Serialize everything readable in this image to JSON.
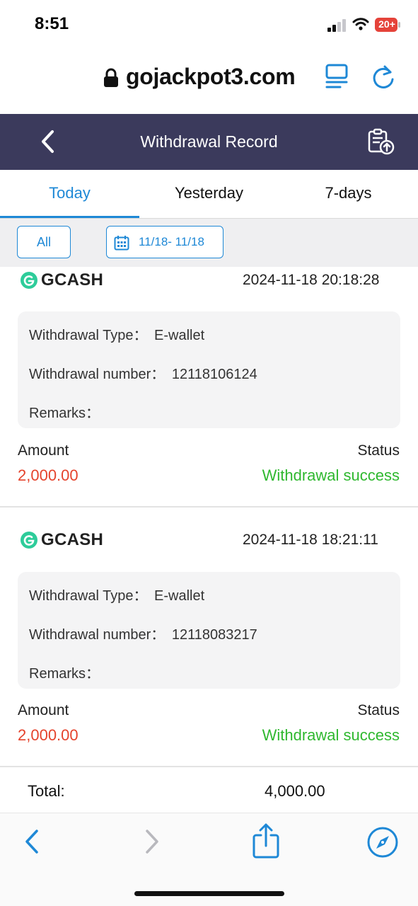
{
  "status_bar": {
    "time": "8:51",
    "battery": "20+"
  },
  "browser": {
    "url": "gojackpot3.com"
  },
  "header": {
    "title": "Withdrawal Record"
  },
  "tabs": [
    {
      "label": "Today",
      "active": true
    },
    {
      "label": "Yesterday",
      "active": false
    },
    {
      "label": "7-days",
      "active": false
    }
  ],
  "filters": {
    "all_label": "All",
    "date_range": "11/18- 11/18"
  },
  "records": [
    {
      "brand": "GCASH",
      "datetime": "2024-11-18 20:18:28",
      "type_label": "Withdrawal Type：",
      "type_value": "E-wallet",
      "number_label": "Withdrawal number：",
      "number_value": "12118106124",
      "remarks_label": "Remarks：",
      "amount_label": "Amount",
      "amount_value": "2,000.00",
      "status_label": "Status",
      "status_value": "Withdrawal success"
    },
    {
      "brand": "GCASH",
      "datetime": "2024-11-18 18:21:11",
      "type_label": "Withdrawal Type：",
      "type_value": "E-wallet",
      "number_label": "Withdrawal number：",
      "number_value": "12118083217",
      "remarks_label": "Remarks：",
      "amount_label": "Amount",
      "amount_value": "2,000.00",
      "status_label": "Status",
      "status_value": "Withdrawal success"
    }
  ],
  "total": {
    "label": "Total:",
    "value": "4,000.00"
  },
  "colors": {
    "header_bg": "#3b3a5c",
    "accent_blue": "#1e88d6",
    "amount_red": "#e5432c",
    "success_green": "#2fb82f",
    "gcash_teal": "#2ecc9a",
    "battery_red": "#e5433a"
  },
  "icons": {
    "lock": "lock-icon",
    "reader": "reader-mode-icon",
    "reload": "reload-icon",
    "back": "chevron-left-icon",
    "record": "clipboard-upload-icon",
    "calendar": "calendar-icon",
    "gcash": "gcash-logo-icon",
    "share": "share-icon",
    "compass": "compass-icon"
  }
}
